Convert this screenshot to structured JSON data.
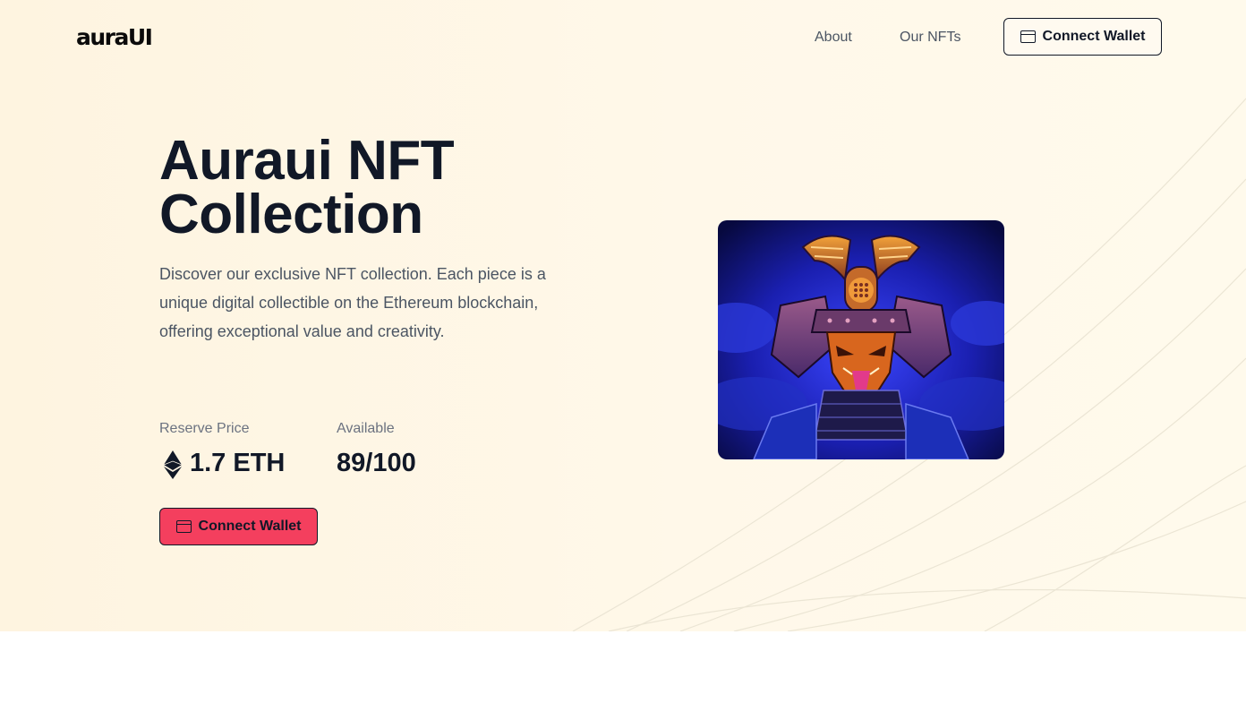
{
  "header": {
    "logo": "auraUI",
    "nav": [
      {
        "label": "About"
      },
      {
        "label": "Our NFTs"
      }
    ],
    "connect_label": "Connect Wallet"
  },
  "hero": {
    "title": "Auraui NFT Collection",
    "description": "Discover our exclusive NFT collection. Each piece is a unique digital collectible on the Ethereum blockchain, offering exceptional value and creativity.",
    "stats": {
      "reserve_label": "Reserve Price",
      "reserve_value": "1.7 ETH",
      "available_label": "Available",
      "available_value": "89/100"
    },
    "cta_label": "Connect Wallet",
    "image_icon": "samurai-mask-image"
  },
  "colors": {
    "accent": "#f43f5e",
    "text": "#111827",
    "muted": "#4b5563",
    "hero_bg": "#fef4e0"
  }
}
